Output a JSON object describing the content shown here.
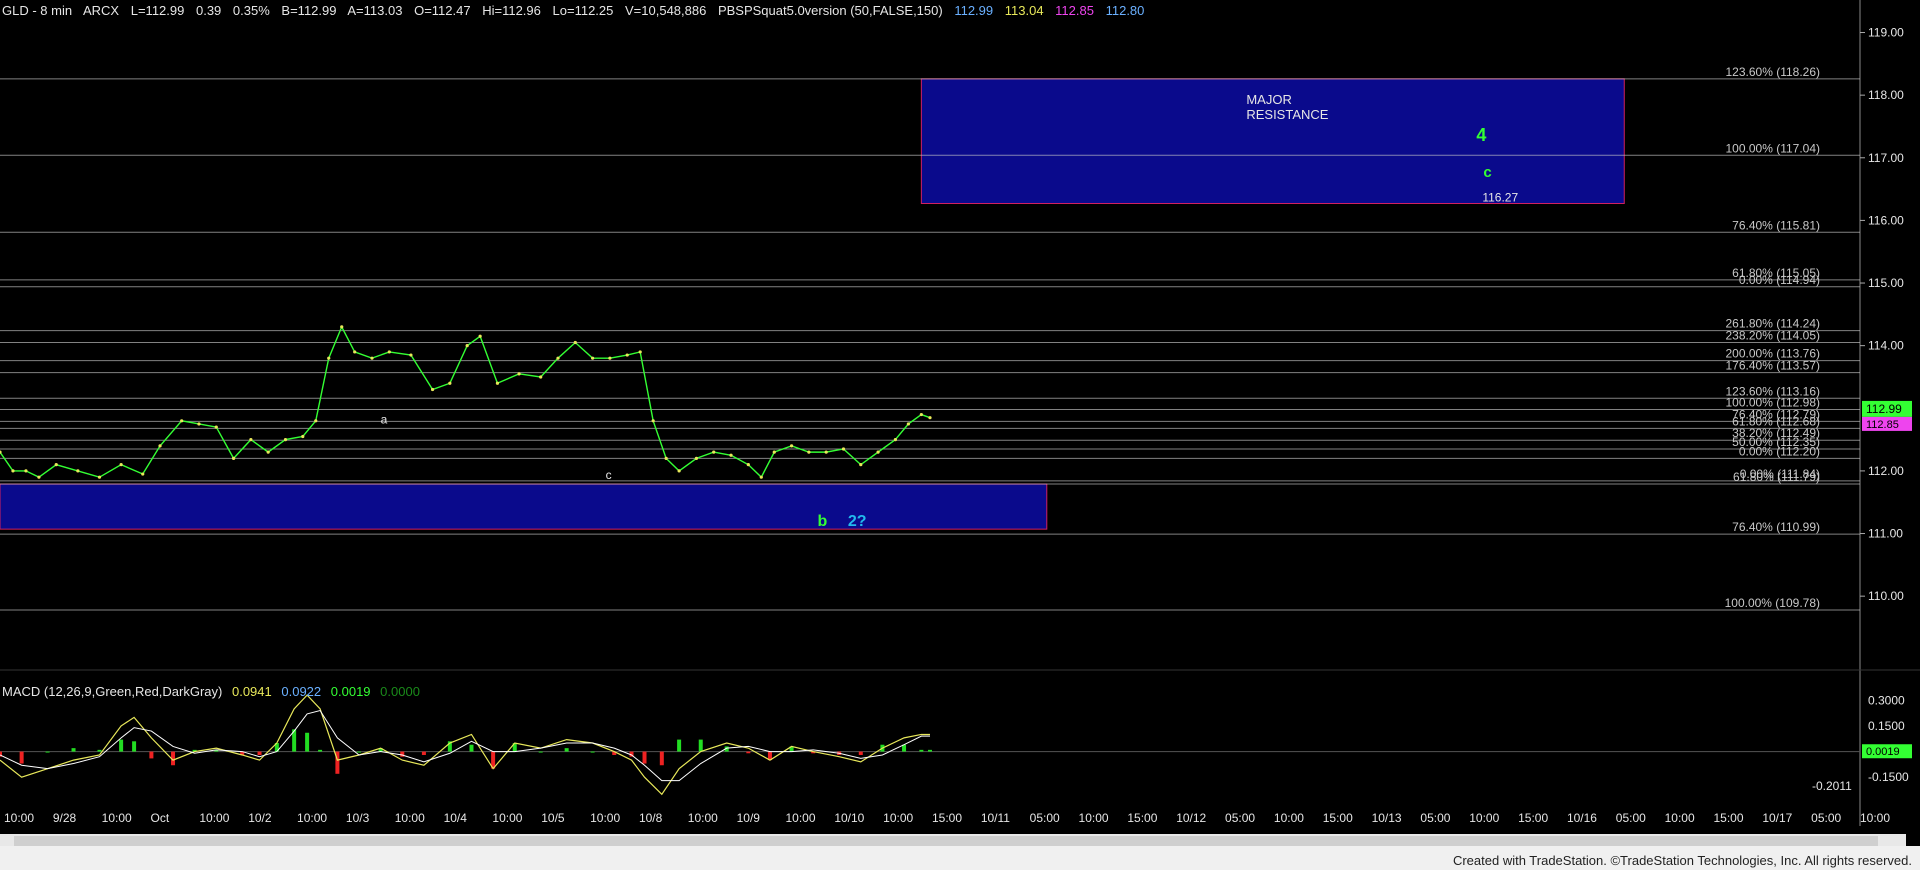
{
  "header": {
    "symbol": "GLD - 8 min",
    "exchange": "ARCX",
    "last": "L=112.99",
    "change": "0.39",
    "pct": "0.35%",
    "bid": "B=112.99",
    "ask": "A=113.03",
    "open": "O=112.47",
    "high": "Hi=112.96",
    "low": "Lo=112.25",
    "volume": "V=10,548,886",
    "study": "PBSPSquat5.0version (50,FALSE,150)",
    "v1": "112.99",
    "v2": "113.04",
    "v3": "112.85",
    "v4": "112.80"
  },
  "macd_header": {
    "name": "MACD (12,26,9,Green,Red,DarkGray)",
    "v1": "0.0941",
    "v2": "0.0922",
    "v3": "0.0019",
    "v4": "0.0000"
  },
  "annotations": {
    "major": "MAJOR",
    "resistance": "RESISTANCE",
    "four": "4",
    "c_top": "c",
    "b": "b",
    "two": "2?",
    "a": "a",
    "c_low": "c",
    "level_11627": "116.27"
  },
  "footer": "Created with TradeStation. ©TradeStation Technologies, Inc. All rights reserved.",
  "colors": {
    "background": "#000000",
    "price": "#33ff33",
    "zone_fill": "#0a0a8c",
    "zone_border": "#d22060",
    "fib_line": "#c8c8c8",
    "macd_line": "#e8e85a",
    "macd_signal": "#ffffff",
    "hist_pos": "#22dd22",
    "hist_neg": "#ee2222",
    "last_price_tag": "#33ff33"
  },
  "chart_data": {
    "type": "line",
    "title": "GLD - 8 min",
    "price_ylim": [
      109.3,
      119.2
    ],
    "price_ticks": [
      "119.00",
      "118.00",
      "117.00",
      "116.00",
      "115.00",
      "114.00",
      "112.00",
      "111.00",
      "110.00"
    ],
    "last_price": 112.99,
    "last_price_tag": "112.99",
    "second_tag": "112.85",
    "x_ticks": [
      "10:00",
      "9/28",
      "10:00",
      "Oct",
      "10:00",
      "10/2",
      "10:00",
      "10/3",
      "10:00",
      "10/4",
      "10:00",
      "10/5",
      "10:00",
      "10/8",
      "10:00",
      "10/9",
      "10:00",
      "10/10",
      "10:00",
      "15:00",
      "10/11",
      "05:00",
      "10:00",
      "15:00",
      "10/12",
      "05:00",
      "10:00",
      "15:00",
      "10/13",
      "05:00",
      "10:00",
      "15:00",
      "10/16",
      "05:00",
      "10:00",
      "15:00",
      "10/17",
      "05:00",
      "10:00"
    ],
    "price_series": [
      {
        "x": 0,
        "y": 112.3
      },
      {
        "x": 6,
        "y": 112.0
      },
      {
        "x": 12,
        "y": 112.0
      },
      {
        "x": 18,
        "y": 111.9
      },
      {
        "x": 26,
        "y": 112.1
      },
      {
        "x": 36,
        "y": 112.0
      },
      {
        "x": 46,
        "y": 111.9
      },
      {
        "x": 56,
        "y": 112.1
      },
      {
        "x": 66,
        "y": 111.95
      },
      {
        "x": 74,
        "y": 112.4
      },
      {
        "x": 84,
        "y": 112.8
      },
      {
        "x": 92,
        "y": 112.75
      },
      {
        "x": 100,
        "y": 112.7
      },
      {
        "x": 108,
        "y": 112.2
      },
      {
        "x": 116,
        "y": 112.5
      },
      {
        "x": 124,
        "y": 112.3
      },
      {
        "x": 132,
        "y": 112.5
      },
      {
        "x": 140,
        "y": 112.55
      },
      {
        "x": 146,
        "y": 112.8
      },
      {
        "x": 152,
        "y": 113.8
      },
      {
        "x": 158,
        "y": 114.3
      },
      {
        "x": 164,
        "y": 113.9
      },
      {
        "x": 172,
        "y": 113.8
      },
      {
        "x": 180,
        "y": 113.9
      },
      {
        "x": 190,
        "y": 113.85
      },
      {
        "x": 200,
        "y": 113.3
      },
      {
        "x": 208,
        "y": 113.4
      },
      {
        "x": 216,
        "y": 114.0
      },
      {
        "x": 222,
        "y": 114.15
      },
      {
        "x": 230,
        "y": 113.4
      },
      {
        "x": 240,
        "y": 113.55
      },
      {
        "x": 250,
        "y": 113.5
      },
      {
        "x": 258,
        "y": 113.8
      },
      {
        "x": 266,
        "y": 114.05
      },
      {
        "x": 274,
        "y": 113.8
      },
      {
        "x": 282,
        "y": 113.8
      },
      {
        "x": 290,
        "y": 113.85
      },
      {
        "x": 296,
        "y": 113.9
      },
      {
        "x": 302,
        "y": 112.8
      },
      {
        "x": 308,
        "y": 112.2
      },
      {
        "x": 314,
        "y": 112.0
      },
      {
        "x": 322,
        "y": 112.2
      },
      {
        "x": 330,
        "y": 112.3
      },
      {
        "x": 338,
        "y": 112.25
      },
      {
        "x": 346,
        "y": 112.1
      },
      {
        "x": 352,
        "y": 111.9
      },
      {
        "x": 358,
        "y": 112.3
      },
      {
        "x": 366,
        "y": 112.4
      },
      {
        "x": 374,
        "y": 112.3
      },
      {
        "x": 382,
        "y": 112.3
      },
      {
        "x": 390,
        "y": 112.35
      },
      {
        "x": 398,
        "y": 112.1
      },
      {
        "x": 406,
        "y": 112.3
      },
      {
        "x": 414,
        "y": 112.5
      },
      {
        "x": 420,
        "y": 112.75
      },
      {
        "x": 426,
        "y": 112.9
      },
      {
        "x": 430,
        "y": 112.85
      }
    ],
    "x_domain": [
      0,
      860
    ],
    "fib_levels": [
      {
        "label": "123.60% (118.26)",
        "value": 118.26
      },
      {
        "label": "100.00% (117.04)",
        "value": 117.04
      },
      {
        "label": "76.40% (115.81)",
        "value": 115.81
      },
      {
        "label": "61.80% (115.05)",
        "value": 115.05
      },
      {
        "label": "0.00% (114.94)",
        "value": 114.94
      },
      {
        "label": "261.80% (114.24)",
        "value": 114.24
      },
      {
        "label": "238.20% (114.05)",
        "value": 114.05
      },
      {
        "label": "200.00% (113.76)",
        "value": 113.76
      },
      {
        "label": "176.40% (113.57)",
        "value": 113.57
      },
      {
        "label": "123.60% (113.16)",
        "value": 113.16
      },
      {
        "label": "100.00% (112.98)",
        "value": 112.98
      },
      {
        "label": "76.40% (112.79)",
        "value": 112.79
      },
      {
        "label": "61.80% (112.68)",
        "value": 112.68
      },
      {
        "label": "38.20% (112.49)",
        "value": 112.49
      },
      {
        "label": "50.00% (112.35)",
        "value": 112.35
      },
      {
        "label": "0.00% (112.20)",
        "value": 112.2
      },
      {
        "label": "0.00% (111.84)",
        "value": 111.84
      },
      {
        "label": "61.80% (111.79)",
        "value": 111.79
      },
      {
        "label": "76.40% (110.99)",
        "value": 110.99
      },
      {
        "label": "100.00% (109.78)",
        "value": 109.78
      }
    ],
    "zones": [
      {
        "x0": 426,
        "x1": 751,
        "y_top": 118.26,
        "y_bottom": 116.27
      },
      {
        "x0": 0,
        "x1": 484,
        "y_top": 111.79,
        "y_bottom": 111.07
      }
    ],
    "macd": {
      "ylim": [
        -0.33,
        0.36
      ],
      "ticks": [
        {
          "label": "0.3000",
          "value": 0.3
        },
        {
          "label": "0.1500",
          "value": 0.15
        },
        {
          "label": "-0.1500",
          "value": -0.15
        }
      ],
      "last_label": "0.0019",
      "last_value": 0.0019,
      "extra_label": "-0.2011",
      "extra_value": -0.2011,
      "macd_series": [
        {
          "x": 0,
          "y": -0.05
        },
        {
          "x": 10,
          "y": -0.15
        },
        {
          "x": 22,
          "y": -0.1
        },
        {
          "x": 34,
          "y": -0.05
        },
        {
          "x": 46,
          "y": -0.02
        },
        {
          "x": 56,
          "y": 0.15
        },
        {
          "x": 62,
          "y": 0.2
        },
        {
          "x": 70,
          "y": 0.08
        },
        {
          "x": 80,
          "y": -0.05
        },
        {
          "x": 90,
          "y": 0.0
        },
        {
          "x": 100,
          "y": 0.02
        },
        {
          "x": 112,
          "y": -0.02
        },
        {
          "x": 120,
          "y": -0.05
        },
        {
          "x": 128,
          "y": 0.05
        },
        {
          "x": 136,
          "y": 0.25
        },
        {
          "x": 142,
          "y": 0.33
        },
        {
          "x": 148,
          "y": 0.25
        },
        {
          "x": 156,
          "y": -0.05
        },
        {
          "x": 166,
          "y": -0.02
        },
        {
          "x": 176,
          "y": 0.02
        },
        {
          "x": 186,
          "y": -0.05
        },
        {
          "x": 196,
          "y": -0.08
        },
        {
          "x": 208,
          "y": 0.05
        },
        {
          "x": 218,
          "y": 0.1
        },
        {
          "x": 228,
          "y": -0.1
        },
        {
          "x": 238,
          "y": 0.05
        },
        {
          "x": 250,
          "y": 0.02
        },
        {
          "x": 262,
          "y": 0.07
        },
        {
          "x": 274,
          "y": 0.05
        },
        {
          "x": 284,
          "y": 0.0
        },
        {
          "x": 292,
          "y": -0.05
        },
        {
          "x": 298,
          "y": -0.15
        },
        {
          "x": 306,
          "y": -0.25
        },
        {
          "x": 314,
          "y": -0.1
        },
        {
          "x": 324,
          "y": 0.0
        },
        {
          "x": 336,
          "y": 0.05
        },
        {
          "x": 346,
          "y": 0.02
        },
        {
          "x": 356,
          "y": -0.05
        },
        {
          "x": 366,
          "y": 0.03
        },
        {
          "x": 376,
          "y": 0.0
        },
        {
          "x": 388,
          "y": -0.03
        },
        {
          "x": 398,
          "y": -0.06
        },
        {
          "x": 408,
          "y": 0.02
        },
        {
          "x": 418,
          "y": 0.08
        },
        {
          "x": 426,
          "y": 0.1
        },
        {
          "x": 430,
          "y": 0.1
        }
      ],
      "signal_series": [
        {
          "x": 0,
          "y": -0.02
        },
        {
          "x": 10,
          "y": -0.08
        },
        {
          "x": 22,
          "y": -0.1
        },
        {
          "x": 34,
          "y": -0.07
        },
        {
          "x": 46,
          "y": -0.03
        },
        {
          "x": 56,
          "y": 0.08
        },
        {
          "x": 62,
          "y": 0.14
        },
        {
          "x": 70,
          "y": 0.12
        },
        {
          "x": 80,
          "y": 0.03
        },
        {
          "x": 90,
          "y": -0.01
        },
        {
          "x": 100,
          "y": 0.01
        },
        {
          "x": 112,
          "y": 0.0
        },
        {
          "x": 120,
          "y": -0.03
        },
        {
          "x": 128,
          "y": 0.0
        },
        {
          "x": 136,
          "y": 0.12
        },
        {
          "x": 142,
          "y": 0.22
        },
        {
          "x": 148,
          "y": 0.24
        },
        {
          "x": 156,
          "y": 0.08
        },
        {
          "x": 166,
          "y": -0.02
        },
        {
          "x": 176,
          "y": 0.0
        },
        {
          "x": 186,
          "y": -0.02
        },
        {
          "x": 196,
          "y": -0.06
        },
        {
          "x": 208,
          "y": -0.01
        },
        {
          "x": 218,
          "y": 0.06
        },
        {
          "x": 228,
          "y": 0.0
        },
        {
          "x": 238,
          "y": 0.0
        },
        {
          "x": 250,
          "y": 0.02
        },
        {
          "x": 262,
          "y": 0.05
        },
        {
          "x": 274,
          "y": 0.05
        },
        {
          "x": 284,
          "y": 0.02
        },
        {
          "x": 292,
          "y": -0.02
        },
        {
          "x": 298,
          "y": -0.08
        },
        {
          "x": 306,
          "y": -0.17
        },
        {
          "x": 314,
          "y": -0.17
        },
        {
          "x": 324,
          "y": -0.07
        },
        {
          "x": 336,
          "y": 0.02
        },
        {
          "x": 346,
          "y": 0.03
        },
        {
          "x": 356,
          "y": 0.0
        },
        {
          "x": 366,
          "y": 0.0
        },
        {
          "x": 376,
          "y": 0.01
        },
        {
          "x": 388,
          "y": -0.01
        },
        {
          "x": 398,
          "y": -0.04
        },
        {
          "x": 408,
          "y": -0.02
        },
        {
          "x": 418,
          "y": 0.04
        },
        {
          "x": 426,
          "y": 0.09
        },
        {
          "x": 430,
          "y": 0.09
        }
      ]
    }
  }
}
